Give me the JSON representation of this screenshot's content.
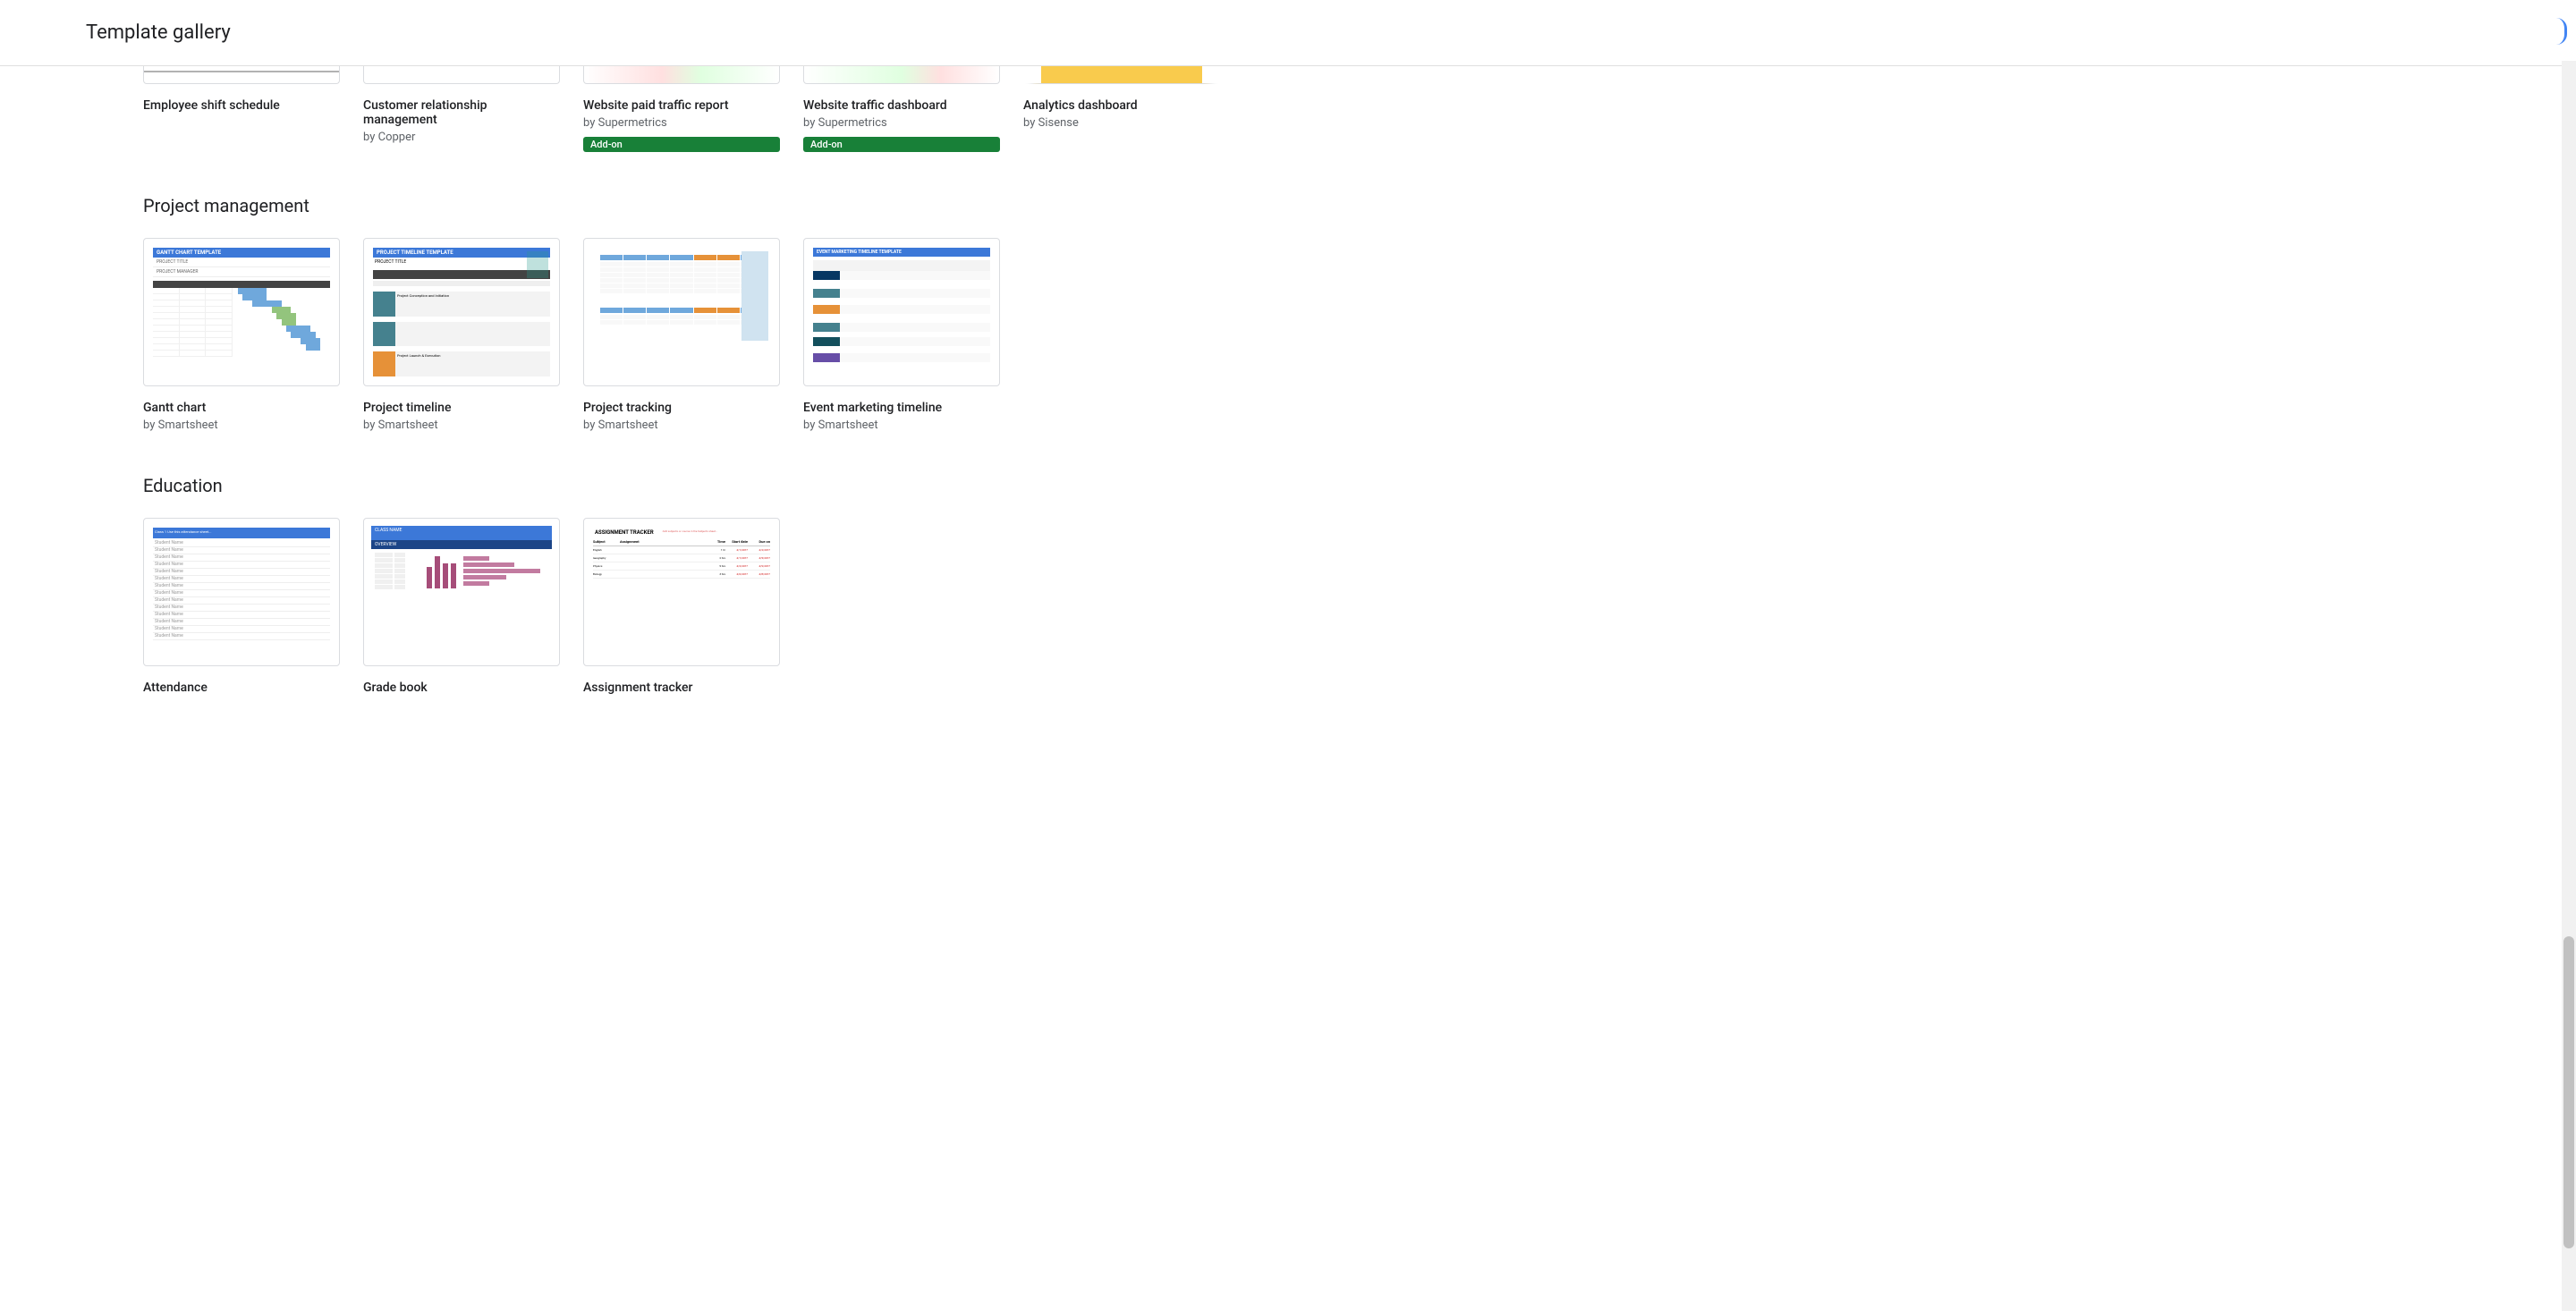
{
  "header": {
    "title": "Template gallery"
  },
  "top_row": {
    "items": [
      {
        "title": "Employee shift schedule",
        "author_prefix": "",
        "author": "",
        "addon": ""
      },
      {
        "title": "Customer relationship management",
        "author_prefix": "by ",
        "author": "Copper",
        "addon": ""
      },
      {
        "title": "Website paid traffic report",
        "author_prefix": "by ",
        "author": "Supermetrics",
        "addon": "Add-on"
      },
      {
        "title": "Website traffic dashboard",
        "author_prefix": "by ",
        "author": "Supermetrics",
        "addon": "Add-on"
      },
      {
        "title": "Analytics dashboard",
        "author_prefix": "by ",
        "author": "Sisense",
        "addon": ""
      }
    ]
  },
  "sections": [
    {
      "title": "Project management",
      "items": [
        {
          "title": "Gantt chart",
          "author_prefix": "by ",
          "author": "Smartsheet"
        },
        {
          "title": "Project timeline",
          "author_prefix": "by ",
          "author": "Smartsheet"
        },
        {
          "title": "Project tracking",
          "author_prefix": "by ",
          "author": "Smartsheet"
        },
        {
          "title": "Event marketing timeline",
          "author_prefix": "by ",
          "author": "Smartsheet"
        }
      ]
    },
    {
      "title": "Education",
      "items": [
        {
          "title": "Attendance",
          "author_prefix": "",
          "author": ""
        },
        {
          "title": "Grade book",
          "author_prefix": "",
          "author": ""
        },
        {
          "title": "Assignment tracker",
          "author_prefix": "",
          "author": ""
        }
      ]
    }
  ],
  "thumb_text": {
    "gantt_title": "GANTT CHART TEMPLATE",
    "ptl_title": "PROJECT TIMELINE TEMPLATE",
    "emt_title": "EVENT MARKETING TIMELINE TEMPLATE",
    "gb_title": "OVERVIEW",
    "at_title": "ASSIGNMENT TRACKER"
  }
}
